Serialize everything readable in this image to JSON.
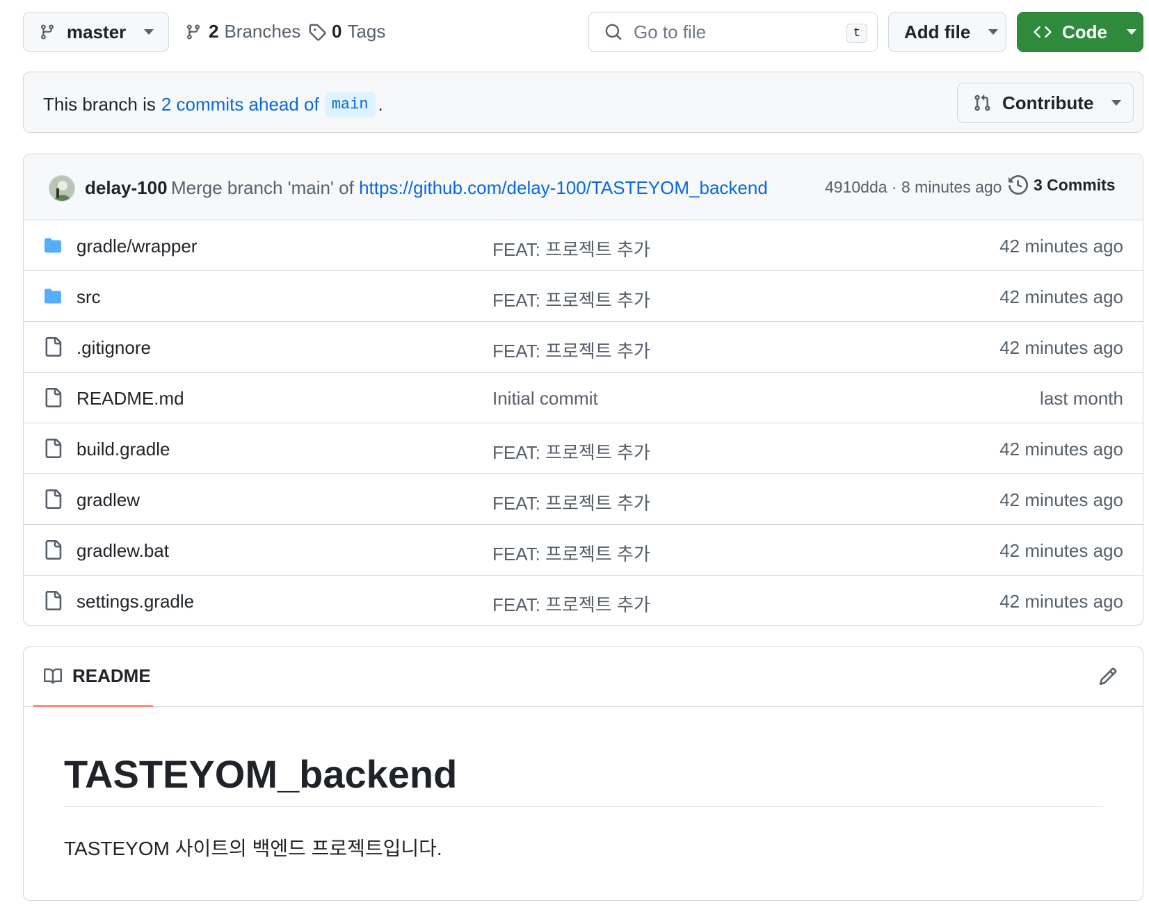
{
  "toolbar": {
    "branch_name": "master",
    "branches_count": "2",
    "branches_label": "Branches",
    "tags_count": "0",
    "tags_label": "Tags",
    "search_placeholder": "Go to file",
    "search_shortcut": "t",
    "add_file_label": "Add file",
    "code_label": "Code"
  },
  "branch_banner": {
    "prefix": "This branch is",
    "link_text": "2 commits ahead of",
    "target_branch": "main",
    "suffix": ".",
    "contribute_label": "Contribute"
  },
  "latest_commit": {
    "author": "delay-100",
    "message_prefix": "Merge branch 'main' of",
    "message_link": "https://github.com/delay-100/TASTEYOM_backend",
    "sha_time": "4910dda · 8 minutes ago",
    "commits_label": "3 Commits"
  },
  "files": [
    {
      "name": "gradle/wrapper",
      "type": "folder",
      "message": "FEAT: 프로젝트 추가",
      "time": "42 minutes ago"
    },
    {
      "name": "src",
      "type": "folder",
      "message": "FEAT: 프로젝트 추가",
      "time": "42 minutes ago"
    },
    {
      "name": ".gitignore",
      "type": "file",
      "message": "FEAT: 프로젝트 추가",
      "time": "42 minutes ago"
    },
    {
      "name": "README.md",
      "type": "file",
      "message": "Initial commit",
      "time": "last month"
    },
    {
      "name": "build.gradle",
      "type": "file",
      "message": "FEAT: 프로젝트 추가",
      "time": "42 minutes ago"
    },
    {
      "name": "gradlew",
      "type": "file",
      "message": "FEAT: 프로젝트 추가",
      "time": "42 minutes ago"
    },
    {
      "name": "gradlew.bat",
      "type": "file",
      "message": "FEAT: 프로젝트 추가",
      "time": "42 minutes ago"
    },
    {
      "name": "settings.gradle",
      "type": "file",
      "message": "FEAT: 프로젝트 추가",
      "time": "42 minutes ago"
    }
  ],
  "readme": {
    "tab_label": "README",
    "title": "TASTEYOM_backend",
    "body": "TASTEYOM 사이트의 백엔드 프로젝트입니다."
  },
  "colors": {
    "accent_blue": "#0969da",
    "code_button_green": "#2f8a3b",
    "folder_icon": "#54aeff",
    "readme_tab_underline": "#fd8c73"
  },
  "icons": {
    "branch": "git-branch-icon",
    "tag": "tag-icon",
    "search": "search-icon",
    "code": "code-icon",
    "pull_request": "git-pull-request-icon",
    "history": "history-icon",
    "folder": "folder-icon",
    "file": "file-icon",
    "book": "book-icon",
    "edit": "pencil-icon"
  }
}
